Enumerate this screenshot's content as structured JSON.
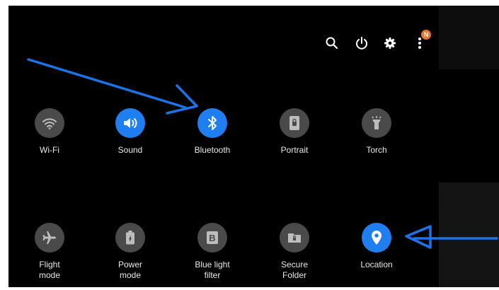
{
  "header": {
    "icons": [
      "search-icon",
      "power-icon",
      "gear-icon",
      "more-vert-icon"
    ],
    "notification_badge": "N"
  },
  "tiles": [
    {
      "label": "Wi-Fi",
      "state": "off",
      "icon": "wifi-icon"
    },
    {
      "label": "Sound",
      "state": "on",
      "icon": "speaker-icon"
    },
    {
      "label": "Bluetooth",
      "state": "on",
      "icon": "bluetooth-icon"
    },
    {
      "label": "Portrait",
      "state": "off",
      "icon": "portrait-lock-icon"
    },
    {
      "label": "Torch",
      "state": "off",
      "icon": "torch-icon"
    },
    {
      "label": "Flight\nmode",
      "state": "off",
      "icon": "airplane-icon"
    },
    {
      "label": "Power\nmode",
      "state": "off",
      "icon": "battery-icon"
    },
    {
      "label": "Blue light\nfilter",
      "state": "off",
      "icon": "blue-light-icon"
    },
    {
      "label": "Secure\nFolder",
      "state": "off",
      "icon": "secure-folder-icon"
    },
    {
      "label": "Location",
      "state": "on",
      "icon": "location-pin-icon"
    }
  ],
  "colors": {
    "active": "#1f7ff0",
    "inactive": "#4a4a4a",
    "arrow": "#1a73e8",
    "badge": "#e8732b"
  }
}
